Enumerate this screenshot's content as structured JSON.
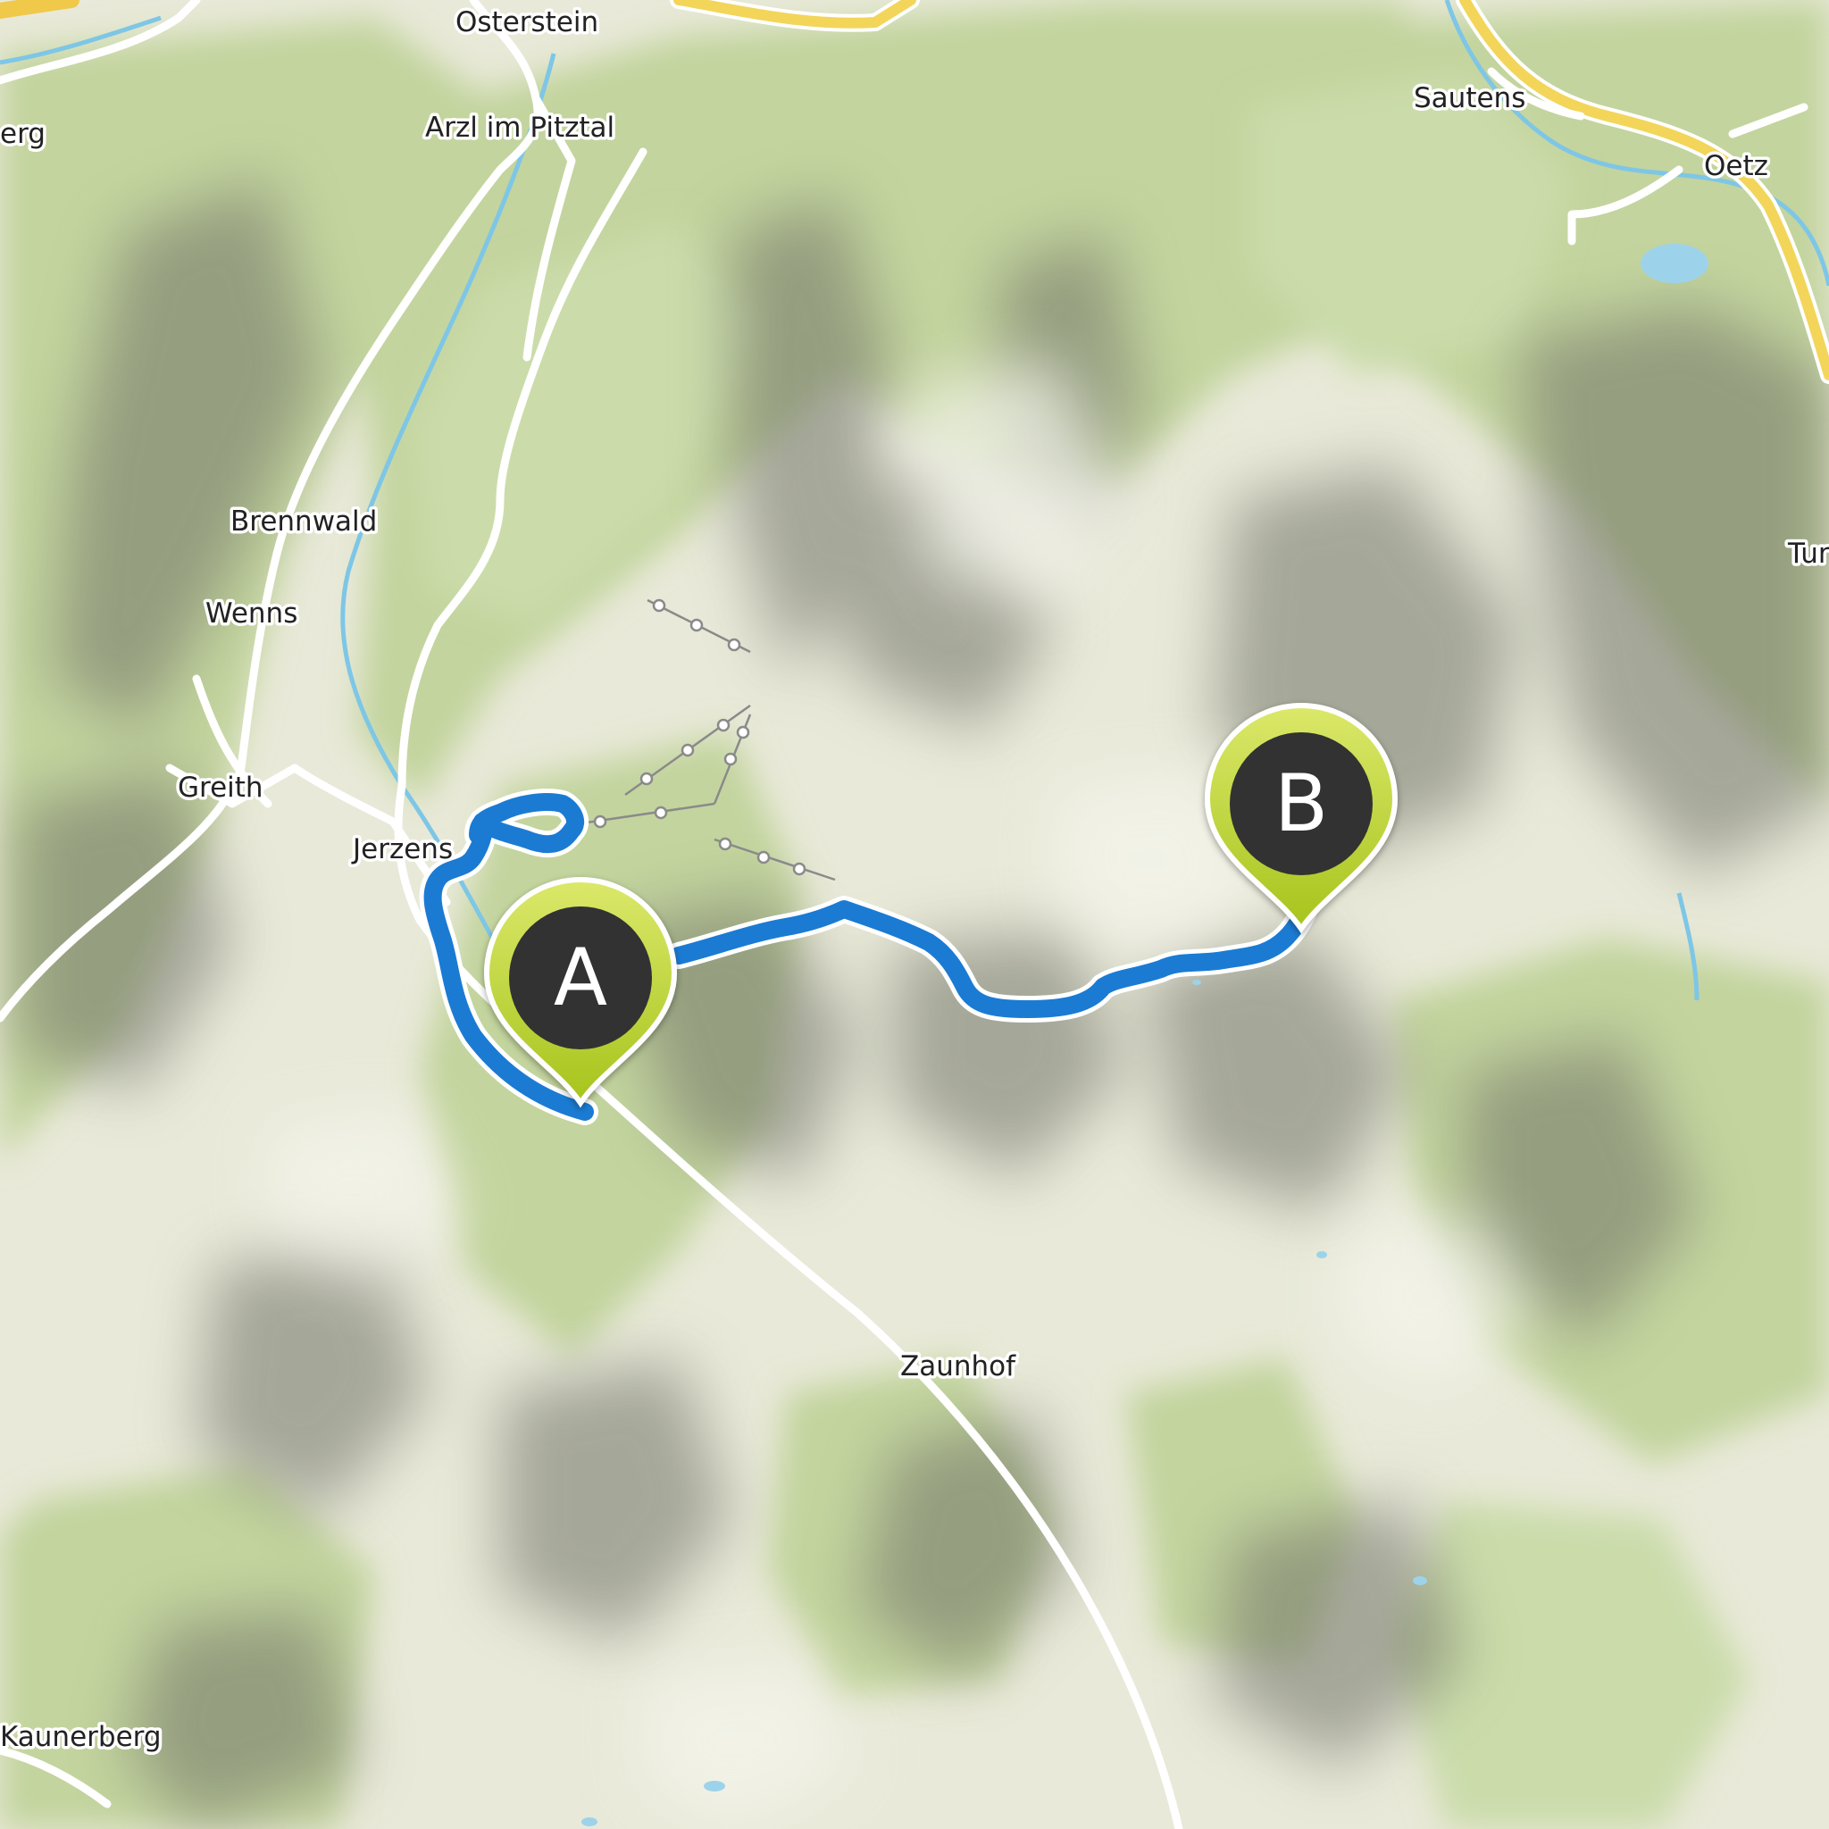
{
  "places": [
    {
      "id": "osterstein",
      "name": "Osterstein"
    },
    {
      "id": "arzl",
      "name": "Arzl im Pitztal"
    },
    {
      "id": "berg-edge",
      "name": "erg"
    },
    {
      "id": "sautens",
      "name": "Sautens"
    },
    {
      "id": "oetz",
      "name": "Oetz"
    },
    {
      "id": "brennwald",
      "name": "Brennwald"
    },
    {
      "id": "wenns",
      "name": "Wenns"
    },
    {
      "id": "greith",
      "name": "Greith"
    },
    {
      "id": "jerzens",
      "name": "Jerzens"
    },
    {
      "id": "tur-edge",
      "name": "Tur"
    },
    {
      "id": "zaunhof",
      "name": "Zaunhof"
    },
    {
      "id": "kaunerberg",
      "name": "Kaunerberg"
    }
  ],
  "markers": {
    "start": {
      "letter": "A"
    },
    "end": {
      "letter": "B"
    }
  },
  "colors": {
    "route": "#1b7bd3",
    "marker_fill": "#b9d52a",
    "marker_badge": "#333333",
    "forest": "#bfd19a",
    "relief_dark": "#7c7f72",
    "highway": "#f3d55a",
    "water": "#7ec6e6"
  },
  "icons": {
    "start-marker": "map-pin-icon",
    "end-marker": "map-pin-icon"
  }
}
